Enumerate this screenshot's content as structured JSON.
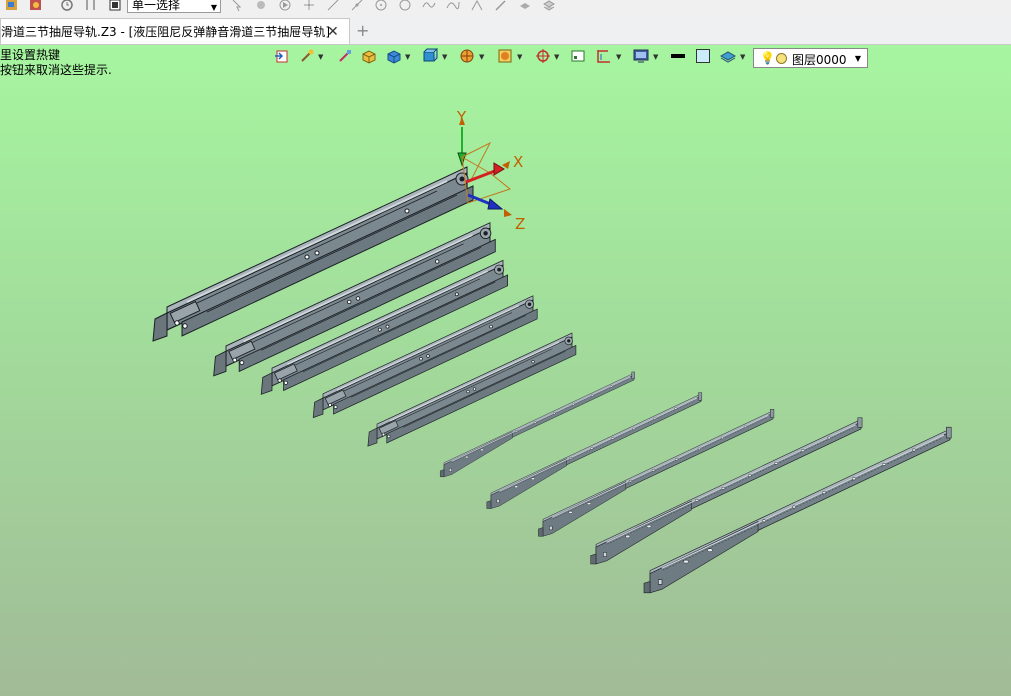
{
  "topbar": {
    "selection_mode": "单一选择"
  },
  "tabs": {
    "active_label": "滑道三节抽屉导轨.Z3 - [液压阻尼反弹静音滑道三节抽屉导轨]",
    "close_symbol": "✕",
    "new_tab_symbol": "+"
  },
  "hints": {
    "line1": "里设置热键",
    "line2": "按钮来取消这些提示."
  },
  "layer": {
    "name": "图层0000"
  },
  "triad": {
    "x_label": "X",
    "y_label": "Y",
    "z_label": "Z"
  },
  "colors": {
    "viewport_top": "#a6f5a0",
    "viewport_bottom": "#a1bb97",
    "part_fill": "#7f8c95",
    "part_edge": "#1c2226",
    "axis_x": "#d42020",
    "axis_y": "#20b030",
    "axis_z": "#2030c0",
    "axis_label": "#c06000"
  }
}
